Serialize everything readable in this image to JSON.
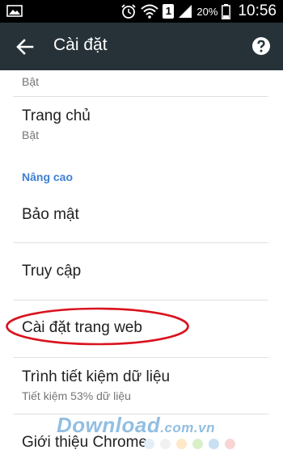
{
  "status_bar": {
    "battery_percent": "20%",
    "time": "10:56",
    "sim_number": "1",
    "icons": [
      "image-icon",
      "alarm-icon",
      "wifi-icon",
      "sim-icon",
      "signal-icon",
      "battery-icon"
    ]
  },
  "toolbar": {
    "title": "Cài đặt",
    "icons": [
      "back-arrow-icon",
      "help-icon"
    ]
  },
  "settings": {
    "partial_item_sub": "Bật",
    "homepage": {
      "label": "Trang chủ",
      "sub": "Bật"
    },
    "section_advanced": "Nâng cao",
    "security": {
      "label": "Bảo mật"
    },
    "accessibility": {
      "label": "Truy cập"
    },
    "site_settings": {
      "label": "Cài đặt trang web"
    },
    "data_saver": {
      "label": "Trình tiết kiệm dữ liệu",
      "sub": "Tiết kiệm 53% dữ liệu"
    },
    "about": {
      "label": "Giới thiệu Chrome"
    }
  },
  "watermark": {
    "text": "Download",
    "domain": ".com.vn",
    "dot_colors": [
      "#e3eef8",
      "#f1f1f1",
      "#ffe8c8",
      "#d8f0c8",
      "#c9dff3",
      "#f8d5d5"
    ]
  },
  "colors": {
    "toolbar_bg": "#263238",
    "section_header": "#3f7fd6",
    "highlight": "#d9131e"
  }
}
